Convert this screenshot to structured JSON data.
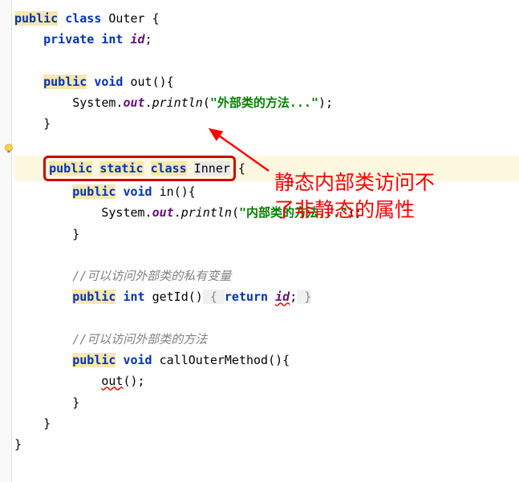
{
  "code": {
    "l1": {
      "kw_public": "public",
      "kw_class": "class",
      "name": "Outer",
      "brace": " {"
    },
    "l2": {
      "kw_private": "private",
      "kw_int": "int",
      "name": "id",
      "end": ";"
    },
    "l3": {
      "kw_public": "public",
      "kw_void": "void",
      "name": "out",
      "parens": "(){"
    },
    "l4": {
      "cls": "System.",
      "fld": "out",
      "dot": ".",
      "mth": "println",
      "op": "(",
      "str": "\"外部类的方法...\"",
      "cl": ");"
    },
    "l5": {
      "brace": "}"
    },
    "l6": {
      "kw_public": "public",
      "kw_static": "static",
      "kw_class": "class",
      "name": "Inner",
      "brace": "{"
    },
    "l7": {
      "kw_public": "public",
      "kw_void": "void",
      "name": "in",
      "parens": "(){"
    },
    "l8": {
      "cls": "System.",
      "fld": "out",
      "dot": ".",
      "mth": "println",
      "op": "(",
      "str": "\"内部类的方法...\"",
      "cl": ");"
    },
    "l9": {
      "brace": "}"
    },
    "l10": {
      "comment": "//可以访问外部类的私有变量"
    },
    "l11": {
      "kw_public": "public",
      "kw_int": "int",
      "name": "getId",
      "parens": "()",
      "ob": " { ",
      "kw_return": "return",
      "sp": " ",
      "fld": "id",
      "end": ";",
      "cb": " }"
    },
    "l12": {
      "comment": "//可以访问外部类的方法"
    },
    "l13": {
      "kw_public": "public",
      "kw_void": "void",
      "name": "callOuterMethod",
      "parens": "(){"
    },
    "l14": {
      "call": "out",
      "parens": "();"
    },
    "l15": {
      "brace": "}"
    },
    "l16": {
      "brace": "}"
    },
    "l17": {
      "brace": "}"
    }
  },
  "annotation": {
    "line1": "静态内部类访问不",
    "line2": "了非静态的属性"
  }
}
